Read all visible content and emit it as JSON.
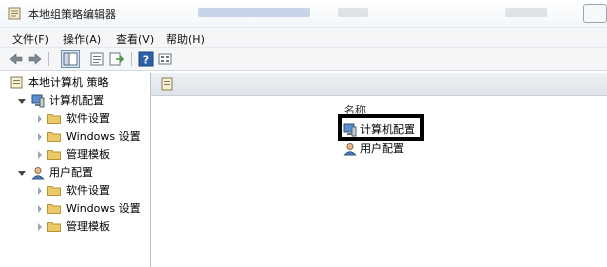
{
  "window": {
    "title": "本地组策略编辑器"
  },
  "menu": {
    "items": [
      "文件(F)",
      "操作(A)",
      "查看(V)",
      "帮助(H)"
    ]
  },
  "toolbar": {
    "buttons": [
      "back-icon",
      "forward-icon",
      "show-tree-icon",
      "properties-icon",
      "export-icon",
      "help-icon",
      "view-icon"
    ]
  },
  "tree": {
    "root": "本地计算机 策略",
    "computer_config": {
      "label": "计算机配置",
      "children": [
        "软件设置",
        "Windows 设置",
        "管理模板"
      ]
    },
    "user_config": {
      "label": "用户配置",
      "children": [
        "软件设置",
        "Windows 设置",
        "管理模板"
      ]
    }
  },
  "list": {
    "column_header": "名称",
    "items": [
      "计算机配置",
      "用户配置"
    ]
  },
  "colors": {
    "highlight_border": "#000000",
    "folder": "#e9c96a",
    "accent": "#3a6fb5"
  }
}
